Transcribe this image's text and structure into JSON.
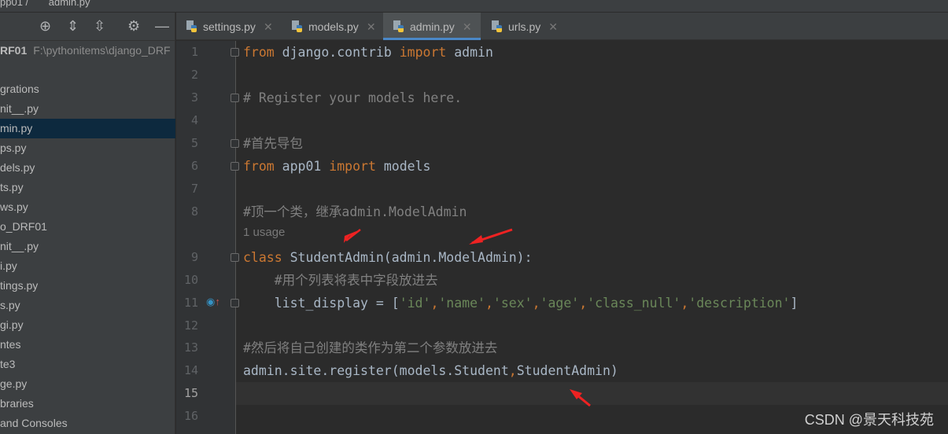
{
  "breadcrumb": {
    "folder": "pp01",
    "file": "admin.py"
  },
  "sidebar": {
    "project_name": "RF01",
    "project_path": "F:\\pythonitems\\django_DRF",
    "items": [
      {
        "label": "grations"
      },
      {
        "label": "nit__.py"
      },
      {
        "label": "min.py",
        "selected": true
      },
      {
        "label": "ps.py"
      },
      {
        "label": "dels.py"
      },
      {
        "label": "ts.py"
      },
      {
        "label": "ws.py"
      },
      {
        "label": "o_DRF01"
      },
      {
        "label": "nit__.py"
      },
      {
        "label": "i.py"
      },
      {
        "label": "tings.py"
      },
      {
        "label": "s.py"
      },
      {
        "label": "gi.py"
      },
      {
        "label": "ntes"
      },
      {
        "label": "te3"
      },
      {
        "label": "ge.py"
      },
      {
        "label": "braries"
      },
      {
        "label": "and Consoles"
      }
    ]
  },
  "tabs": [
    {
      "label": "settings.py"
    },
    {
      "label": "models.py"
    },
    {
      "label": "admin.py",
      "active": true
    },
    {
      "label": "urls.py"
    }
  ],
  "editor": {
    "usage_hint": "1 usage",
    "current_line": 15,
    "lines": [
      [
        [
          "k",
          "from"
        ],
        [
          "t",
          " django.contrib "
        ],
        [
          "k",
          "import"
        ],
        [
          "t",
          " admin"
        ]
      ],
      [],
      [
        [
          "c",
          "# Register your models here."
        ]
      ],
      [],
      [
        [
          "c",
          "#首先导包"
        ]
      ],
      [
        [
          "k",
          "from"
        ],
        [
          "t",
          " app01 "
        ],
        [
          "k",
          "import"
        ],
        [
          "t",
          " models"
        ]
      ],
      [],
      [
        [
          "c",
          "#顶一个类，继承admin.ModelAdmin"
        ]
      ],
      [
        [
          "k",
          "class"
        ],
        [
          "t",
          " StudentAdmin(admin.ModelAdmin):"
        ]
      ],
      [
        [
          "c",
          "    #用个列表将表中字段放进去"
        ]
      ],
      [
        [
          "t",
          "    list_display = ["
        ],
        [
          "s",
          "'id'"
        ],
        [
          "k",
          ","
        ],
        [
          "s",
          "'name'"
        ],
        [
          "k",
          ","
        ],
        [
          "s",
          "'sex'"
        ],
        [
          "k",
          ","
        ],
        [
          "s",
          "'age'"
        ],
        [
          "k",
          ","
        ],
        [
          "s",
          "'class_null'"
        ],
        [
          "k",
          ","
        ],
        [
          "s",
          "'description'"
        ],
        [
          "t",
          "]"
        ]
      ],
      [],
      [
        [
          "c",
          "#然后将自己创建的类作为第二个参数放进去"
        ]
      ],
      [
        [
          "t",
          "admin.site.register(models.Student"
        ],
        [
          "k",
          ","
        ],
        [
          "t",
          "StudentAdmin)"
        ]
      ],
      [],
      []
    ]
  },
  "watermark": "CSDN @景天科技苑"
}
